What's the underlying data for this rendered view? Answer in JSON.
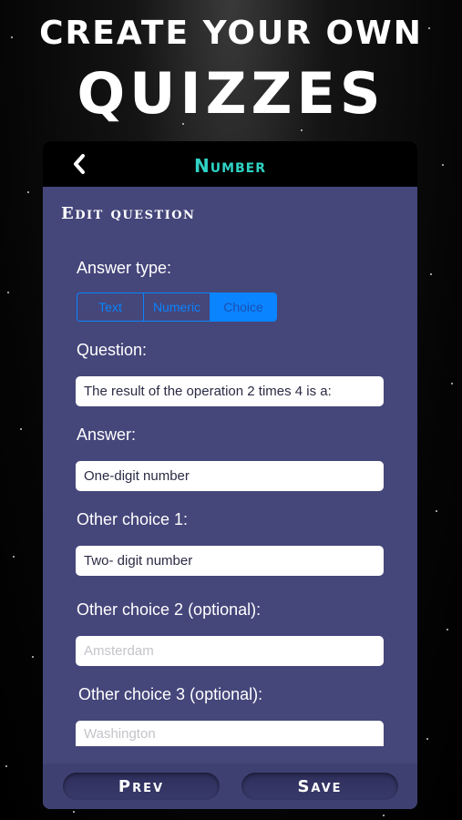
{
  "promo": {
    "line1": "CREATE YOUR OWN",
    "line2": "QUIZZES"
  },
  "navbar": {
    "title": "Number",
    "back_icon": "chevron-left-icon"
  },
  "form": {
    "section_title": "Edit question",
    "answer_type_label": "Answer type:",
    "answer_types": [
      "Text",
      "Numeric",
      "Choice"
    ],
    "selected_answer_type": "Choice",
    "question_label": "Question:",
    "question_value": "The result of the operation 2 times 4 is a:",
    "answer_label": "Answer:",
    "answer_value": "One-digit number",
    "choice1_label": "Other choice 1:",
    "choice1_value": "Two- digit number",
    "choice2_label": "Other choice 2 (optional):",
    "choice2_placeholder": "Amsterdam",
    "choice3_label": "Other choice 3 (optional):",
    "choice3_placeholder": "Washington"
  },
  "footer": {
    "prev_label": "Prev",
    "save_label": "Save"
  },
  "colors": {
    "panel": "#45467a",
    "accent_title": "#2fd3c4",
    "segment_accent": "#0a84ff"
  }
}
